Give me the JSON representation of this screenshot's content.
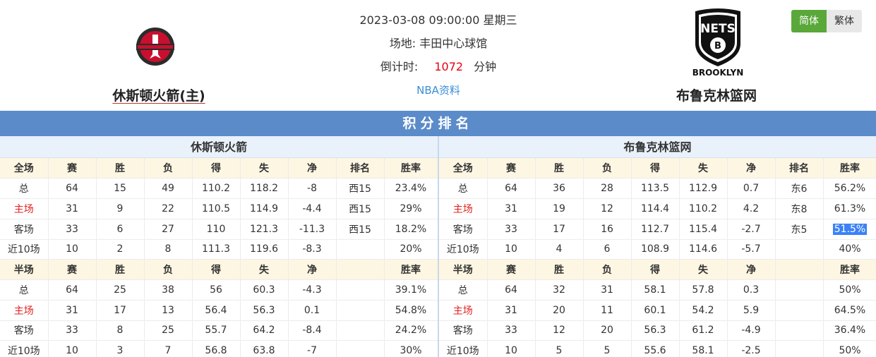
{
  "match": {
    "datetime": "2023-03-08 09:00:00 星期三",
    "venue_label": "场地:",
    "venue": "丰田中心球馆",
    "countdown_label": "倒计时:",
    "countdown_value": "1072",
    "countdown_unit": "分钟",
    "nba_link": "NBA资料"
  },
  "home_team": {
    "name": "休斯顿火箭(主)",
    "logo_icon": "houston-rockets-logo"
  },
  "away_team": {
    "name": "布鲁克林篮网",
    "logo_icon": "brooklyn-nets-logo",
    "logo_text_top": "NETS",
    "logo_text_bottom": "BROOKLYN"
  },
  "lang": {
    "simplified": "简体",
    "traditional": "繁体"
  },
  "standings": {
    "title": "积分排名",
    "left": {
      "team": "休斯顿火箭",
      "full_header": [
        "全场",
        "赛",
        "胜",
        "负",
        "得",
        "失",
        "净",
        "排名",
        "胜率"
      ],
      "full_rows": [
        [
          "总",
          "64",
          "15",
          "49",
          "110.2",
          "118.2",
          "-8",
          "西15",
          "23.4%"
        ],
        [
          "主场",
          "31",
          "9",
          "22",
          "110.5",
          "114.9",
          "-4.4",
          "西15",
          "29%"
        ],
        [
          "客场",
          "33",
          "6",
          "27",
          "110",
          "121.3",
          "-11.3",
          "西15",
          "18.2%"
        ],
        [
          "近10场",
          "10",
          "2",
          "8",
          "111.3",
          "119.6",
          "-8.3",
          "",
          "20%"
        ]
      ],
      "half_header": [
        "半场",
        "赛",
        "胜",
        "负",
        "得",
        "失",
        "净",
        "",
        "胜率"
      ],
      "half_rows": [
        [
          "总",
          "64",
          "25",
          "38",
          "56",
          "60.3",
          "-4.3",
          "",
          "39.1%"
        ],
        [
          "主场",
          "31",
          "17",
          "13",
          "56.4",
          "56.3",
          "0.1",
          "",
          "54.8%"
        ],
        [
          "客场",
          "33",
          "8",
          "25",
          "55.7",
          "64.2",
          "-8.4",
          "",
          "24.2%"
        ],
        [
          "近10场",
          "10",
          "3",
          "7",
          "56.8",
          "63.8",
          "-7",
          "",
          "30%"
        ]
      ]
    },
    "right": {
      "team": "布鲁克林篮网",
      "full_header": [
        "全场",
        "赛",
        "胜",
        "负",
        "得",
        "失",
        "净",
        "排名",
        "胜率"
      ],
      "full_rows": [
        [
          "总",
          "64",
          "36",
          "28",
          "113.5",
          "112.9",
          "0.7",
          "东6",
          "56.2%"
        ],
        [
          "主场",
          "31",
          "19",
          "12",
          "114.4",
          "110.2",
          "4.2",
          "东8",
          "61.3%"
        ],
        [
          "客场",
          "33",
          "17",
          "16",
          "112.7",
          "115.4",
          "-2.7",
          "东5",
          "51.5%"
        ],
        [
          "近10场",
          "10",
          "4",
          "6",
          "108.9",
          "114.6",
          "-5.7",
          "",
          "40%"
        ]
      ],
      "half_header": [
        "半场",
        "赛",
        "胜",
        "负",
        "得",
        "失",
        "净",
        "",
        "胜率"
      ],
      "half_rows": [
        [
          "总",
          "64",
          "32",
          "31",
          "58.1",
          "57.8",
          "0.3",
          "",
          "50%"
        ],
        [
          "主场",
          "31",
          "20",
          "11",
          "60.1",
          "54.2",
          "5.9",
          "",
          "64.5%"
        ],
        [
          "客场",
          "33",
          "12",
          "20",
          "56.3",
          "61.2",
          "-4.9",
          "",
          "36.4%"
        ],
        [
          "近10场",
          "10",
          "5",
          "5",
          "55.6",
          "58.1",
          "-2.5",
          "",
          "50%"
        ]
      ]
    }
  },
  "colors": {
    "banner": "#5b8cc9",
    "accent_red": "#e02020",
    "lang_active": "#5aa83a"
  }
}
